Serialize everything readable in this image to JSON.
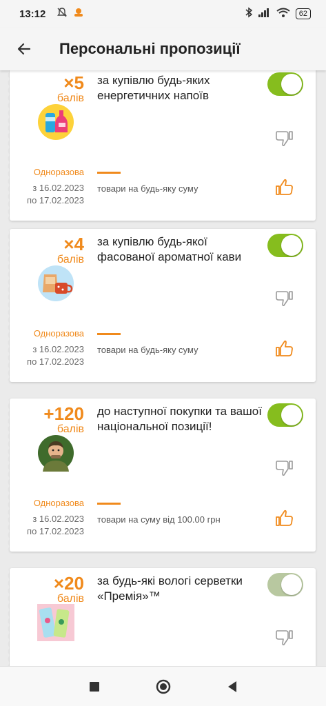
{
  "status_bar": {
    "time": "13:12",
    "battery": "62"
  },
  "header": {
    "title": "Персональні пропозиції"
  },
  "offers": [
    {
      "multiplier": "×5",
      "points_unit": "балів",
      "description": "за купівлю будь-яких енергетичних напоїв",
      "frequency": "Одноразова",
      "date_from": "з 16.02.2023",
      "date_to": "по 17.02.2023",
      "condition": "товари на будь-яку суму",
      "image": "energy-drinks-icon",
      "enabled": true
    },
    {
      "multiplier": "×4",
      "points_unit": "балів",
      "description": "за купівлю будь-якої фасованої ароматної кави",
      "frequency": "Одноразова",
      "date_from": "з 16.02.2023",
      "date_to": "по 17.02.2023",
      "condition": "товари на будь-яку суму",
      "image": "coffee-icon",
      "enabled": true
    },
    {
      "multiplier": "+120",
      "points_unit": "балів",
      "description": "до наступної покупки та вашої національної позиції!",
      "frequency": "Одноразова",
      "date_from": "з 16.02.2023",
      "date_to": "по 17.02.2023",
      "condition": "товари на суму від 100.00 грн",
      "image": "soldier-avatar-icon",
      "enabled": true
    },
    {
      "multiplier": "×20",
      "points_unit": "балів",
      "description": "за будь-які вологі серветки «Премія»™",
      "image": "wet-wipes-icon",
      "enabled": true
    }
  ],
  "colors": {
    "accent": "#f08a1c",
    "toggle_on": "#86bd1e",
    "background": "#ebebeb"
  }
}
